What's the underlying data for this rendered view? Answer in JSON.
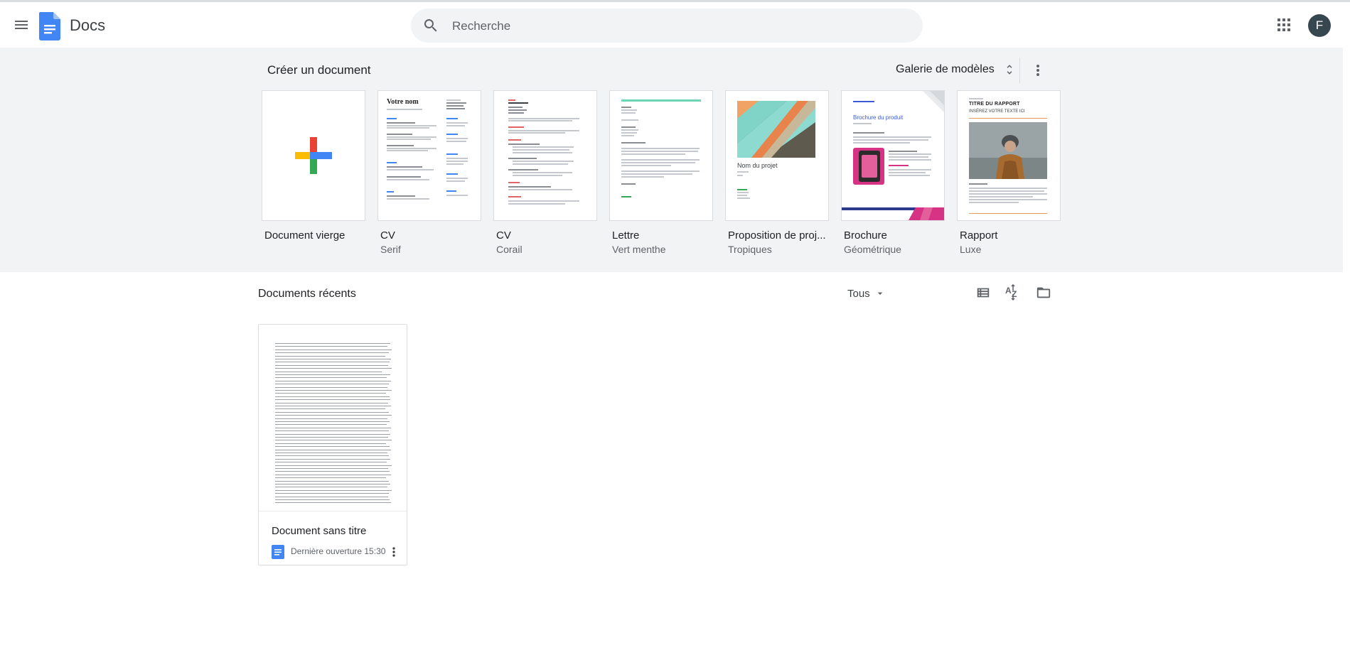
{
  "header": {
    "app_title": "Docs",
    "search_placeholder": "Recherche",
    "avatar_letter": "F",
    "icons": [
      "menu-icon",
      "docs-logo-icon",
      "search-icon",
      "apps-grid-icon"
    ]
  },
  "templates": {
    "heading": "Créer un document",
    "gallery_label": "Galerie de modèles",
    "items": [
      {
        "name": "Document vierge",
        "sub": ""
      },
      {
        "name": "CV",
        "sub": "Serif",
        "thumb_title": "Votre nom"
      },
      {
        "name": "CV",
        "sub": "Corail"
      },
      {
        "name": "Lettre",
        "sub": "Vert menthe"
      },
      {
        "name": "Proposition de proj...",
        "sub": "Tropiques",
        "thumb_title": "Nom du projet"
      },
      {
        "name": "Brochure",
        "sub": "Géométrique",
        "thumb_title": "Brochure du produit"
      },
      {
        "name": "Rapport",
        "sub": "Luxe",
        "thumb_title": "TITRE DU RAPPORT",
        "thumb_subtitle": "INSÉREZ VOTRE TEXTE ICI"
      }
    ]
  },
  "recent": {
    "title": "Documents récents",
    "filter_label": "Tous",
    "documents": [
      {
        "name": "Document sans titre",
        "meta": "Dernière ouverture 15:30"
      }
    ]
  },
  "colors": {
    "accent": "#1a73e8",
    "band_bg": "#f1f3f4",
    "google_blue": "#4285f4",
    "google_red": "#ea4335",
    "google_yellow": "#fbbc04",
    "google_green": "#34a853"
  }
}
